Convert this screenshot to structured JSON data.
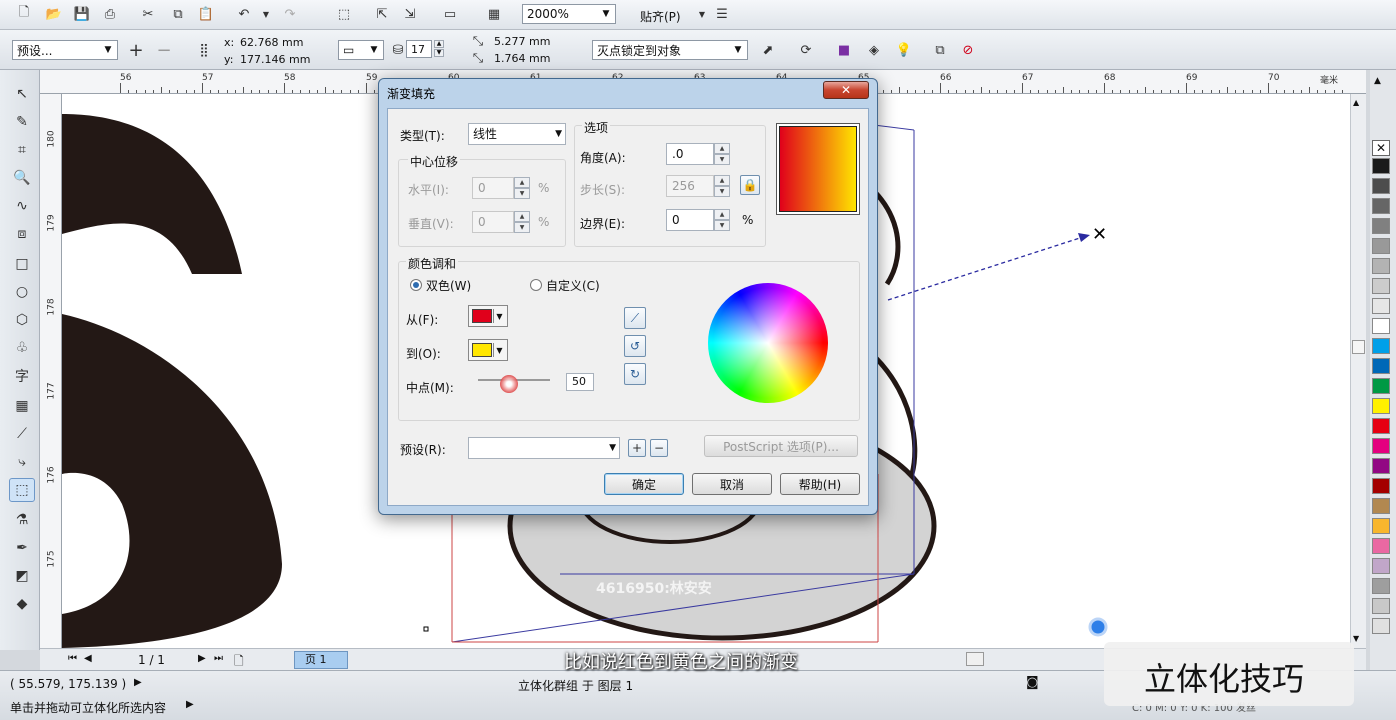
{
  "toolbar1": {
    "zoom_value": "2000%",
    "snap_label": "贴齐(P)"
  },
  "toolbar2": {
    "preset_value": "预设...",
    "x_label": "x:",
    "x_value": "62.768 mm",
    "y_label": "y:",
    "y_value": "177.146 mm",
    "depth_value": "17",
    "vp_x_value": "5.277 mm",
    "vp_y_value": "1.764 mm",
    "vp_lock_value": "灭点锁定到对象"
  },
  "ruler_top": {
    "ticks": [
      "56",
      "57",
      "58",
      "59",
      "60",
      "61",
      "62",
      "63",
      "64",
      "65",
      "66",
      "67",
      "68",
      "69",
      "70"
    ],
    "unit": "毫米"
  },
  "ruler_left": {
    "ticks": [
      "180",
      "179",
      "178",
      "177",
      "176",
      "175"
    ]
  },
  "dialog": {
    "title": "渐变填充",
    "close_label": "✕",
    "type_label": "类型(T):",
    "type_value": "线性",
    "center_offset_label": "中心位移",
    "horizontal_label": "水平(I):",
    "horizontal_value": "0",
    "vertical_label": "垂直(V):",
    "vertical_value": "0",
    "percent": "%",
    "options_label": "选项",
    "angle_label": "角度(A):",
    "angle_value": ".0",
    "steps_label": "步长(S):",
    "steps_value": "256",
    "edge_label": "边界(E):",
    "edge_value": "0",
    "color_blend_label": "颜色调和",
    "two_color_label": "双色(W)",
    "custom_label": "自定义(C)",
    "from_label": "从(F):",
    "to_label": "到(O):",
    "midpoint_label": "中点(M):",
    "midpoint_value": "50",
    "presets_label": "预设(R):",
    "presets_value": "",
    "postscript_label": "PostScript 选项(P)...",
    "ok_label": "确定",
    "cancel_label": "取消",
    "help_label": "帮助(H)"
  },
  "colors": {
    "from": "#e0001b",
    "to": "#ffe600",
    "shape_dark": "#231815"
  },
  "pagebar": {
    "page_count": "1 / 1",
    "page_tab": "页 1"
  },
  "statusbar": {
    "coords": "( 55.579, 175.139 )",
    "object_info": "立体化群组 于 图层 1",
    "hint": "单击并拖动可立体化所选内容",
    "fill_info": "C: 0 M: 0 Y: 0 K: 100  发丝"
  },
  "overlay": {
    "subtitle": "比如说红色到黄色之间的渐变",
    "brand": "立体化技巧",
    "watermark": "4616950:林安安"
  },
  "palette_colors": [
    "#1a1a1a",
    "#4d4d4d",
    "#666666",
    "#808080",
    "#999999",
    "#b3b3b3",
    "#cccccc",
    "#e6e6e6",
    "#ffffff",
    "#00a0e9",
    "#0068b7",
    "#009944",
    "#fff100",
    "#e60012",
    "#e4007f",
    "#920783",
    "#a40000",
    "#b28850",
    "#f8b62d",
    "#ea68a2",
    "#c1a6c9",
    "#9e9e9e",
    "#c8c8c8",
    "#e0e0e0"
  ]
}
